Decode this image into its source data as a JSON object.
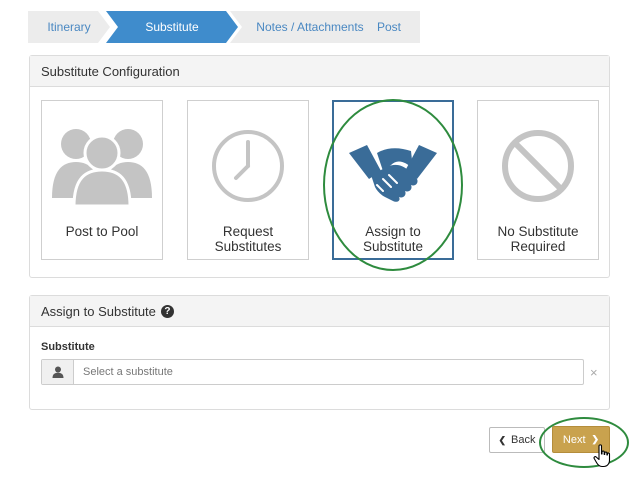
{
  "wizard": {
    "steps": [
      {
        "label": "Itinerary"
      },
      {
        "label": "Substitute"
      },
      {
        "label": "Notes / Attachments"
      },
      {
        "label": "Post"
      }
    ],
    "active_index": 1
  },
  "config": {
    "title": "Substitute Configuration",
    "options": [
      {
        "label_line1": "Post to Pool",
        "label_line2": "",
        "icon": "people-group-icon"
      },
      {
        "label_line1": "Request",
        "label_line2": "Substitutes",
        "icon": "clock-icon"
      },
      {
        "label_line1": "Assign to",
        "label_line2": "Substitute",
        "icon": "handshake-icon"
      },
      {
        "label_line1": "No Substitute",
        "label_line2": "Required",
        "icon": "prohibited-icon"
      }
    ],
    "selected_index": 2
  },
  "assign": {
    "title": "Assign to Substitute",
    "field_label": "Substitute",
    "placeholder": "Select a substitute",
    "value": "",
    "clear": "×"
  },
  "buttons": {
    "back_label": "Back",
    "next_label": "Next",
    "back_chevron": "❮",
    "next_chevron": "❯"
  },
  "colors": {
    "active_step": "#3f8ccc",
    "inactive_step": "#ececec",
    "selected_border": "#3a6c98",
    "next_button": "#c9a24e",
    "annotation": "#2e8b3e",
    "icon_gray": "#c4c4c4",
    "handshake_blue": "#3a6c98"
  }
}
